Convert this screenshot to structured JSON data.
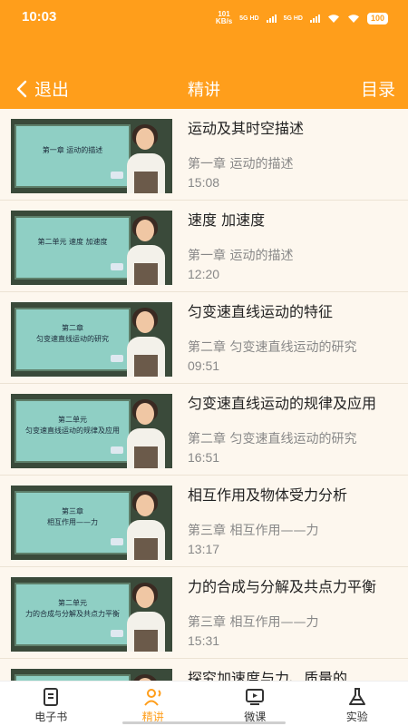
{
  "status_bar": {
    "time": "10:03",
    "net_speed_value": "101",
    "net_speed_unit": "KB/s",
    "signal_1": "5G HD",
    "signal_2": "5G HD",
    "battery": "100"
  },
  "header": {
    "back_label": "退出",
    "title": "精讲",
    "catalog_label": "目录"
  },
  "lessons": [
    {
      "title": "运动及其时空描述",
      "chapter": "第一章  运动的描述",
      "duration": "15:08",
      "board_text": [
        "第一章  运动的描述"
      ]
    },
    {
      "title": "速度  加速度",
      "chapter": "第一章  运动的描述",
      "duration": "12:20",
      "board_text": [
        "第二单元  速度  加速度"
      ]
    },
    {
      "title": "匀变速直线运动的特征",
      "chapter": "第二章  匀变速直线运动的研究",
      "duration": "09:51",
      "board_text": [
        "第二章",
        "匀变速直线运动的研究"
      ]
    },
    {
      "title": "匀变速直线运动的规律及应用",
      "chapter": "第二章  匀变速直线运动的研究",
      "duration": "16:51",
      "board_text": [
        "第二单元",
        "匀变速直线运动的规律及应用"
      ]
    },
    {
      "title": "相互作用及物体受力分析",
      "chapter": "第三章  相互作用——力",
      "duration": "13:17",
      "board_text": [
        "第三章",
        "相互作用——力"
      ]
    },
    {
      "title": "力的合成与分解及共点力平衡",
      "chapter": "第三章  相互作用——力",
      "duration": "15:31",
      "board_text": [
        "第二单元",
        "力的合成与分解及共点力平衡"
      ]
    },
    {
      "title": "探究加速度与力、质量的",
      "chapter": "",
      "duration": "",
      "board_text": []
    }
  ],
  "tabs": [
    {
      "label": "电子书",
      "icon": "ebook-icon"
    },
    {
      "label": "精讲",
      "icon": "lecture-icon"
    },
    {
      "label": "微课",
      "icon": "video-icon"
    },
    {
      "label": "实验",
      "icon": "flask-icon"
    }
  ],
  "colors": {
    "accent": "#ff9e1b",
    "list_bg": "#fdf7ee",
    "secondary_text": "#888888"
  }
}
